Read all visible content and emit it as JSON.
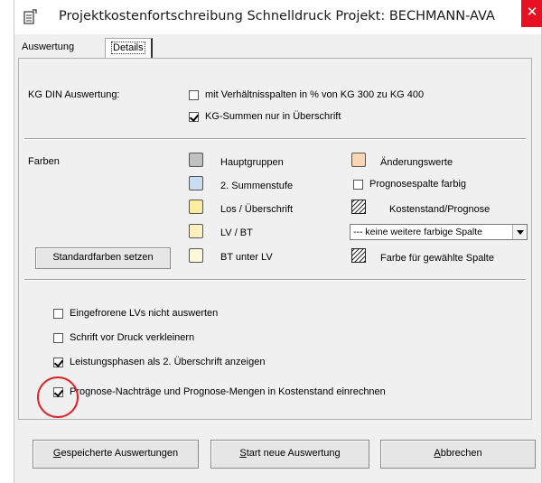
{
  "window": {
    "title": "Projektkostenfortschreibung Schnelldruck  Projekt: BECHMANN-AVA",
    "close_glyph": "✕"
  },
  "tabs": [
    {
      "label": "Auswertung",
      "active": false
    },
    {
      "label": "Details",
      "active": true
    }
  ],
  "kg_din": {
    "label": "KG DIN Auswertung:",
    "option1": {
      "label": "mit Verhältnisspalten in % von KG 300 zu KG 400",
      "checked": false
    },
    "option2": {
      "label": "KG-Summen nur in Überschrift",
      "checked": true
    }
  },
  "farben": {
    "label": "Farben",
    "left_items": [
      {
        "label": "Hauptgruppen",
        "color": "#c0c0c0"
      },
      {
        "label": "2. Summenstufe",
        "color": "#c9dcf2"
      },
      {
        "label": "Los / Überschrift",
        "color": "#fbeca0"
      },
      {
        "label": "LV / BT",
        "color": "#fcf1bf"
      },
      {
        "label": "BT unter LV",
        "color": "#fdf8dc"
      }
    ],
    "aenderungswerte": {
      "label": "Änderungswerte",
      "color": "#f8d6b4"
    },
    "prognosespalte": {
      "label": "Prognosespalte farbig",
      "checked": false
    },
    "kostenstand": {
      "label": "Kostenstand/Prognose"
    },
    "spalte_select": {
      "value": "--- keine weitere farbige Spalte"
    },
    "gewaehlte_spalte": {
      "label": "Farbe für gewählte Spalte"
    },
    "standard_button": "Standardfarben setzen"
  },
  "options": [
    {
      "label": "Eingefrorene LVs nicht auswerten",
      "checked": false
    },
    {
      "label": "Schrift vor Druck verkleinern",
      "checked": false
    },
    {
      "label": "Leistungsphasen als 2. Überschrift anzeigen",
      "checked": true
    },
    {
      "label": "Prognose-Nachträge und Prognose-Mengen in Kostenstand einrechnen",
      "checked": true
    }
  ],
  "footer": {
    "saved_button": {
      "first": "G",
      "rest": "espeicherte Auswertungen"
    },
    "start_button": {
      "first": "S",
      "rest": "tart neue Auswertung"
    },
    "cancel_button": {
      "first": "A",
      "rest": "bbrechen"
    }
  },
  "colors": {
    "highlight_circle": "#d9262c",
    "close_button": "#e81123"
  }
}
